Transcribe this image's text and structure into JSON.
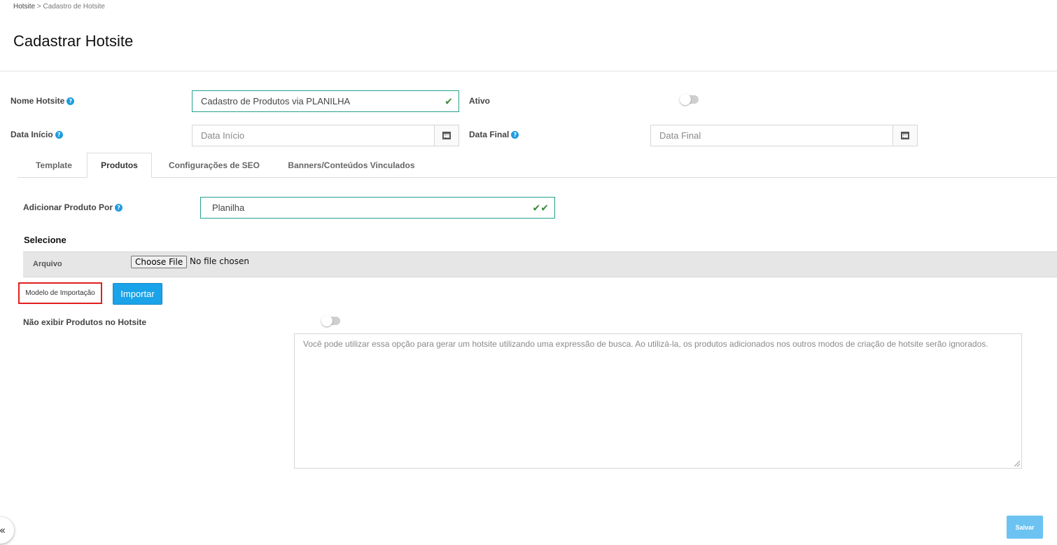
{
  "breadcrumb": {
    "root": "Hotsite",
    "separator": ">",
    "current": "Cadastro de Hotsite"
  },
  "page_title": "Cadastrar Hotsite",
  "form": {
    "nome_hotsite": {
      "label": "Nome Hotsite",
      "value": "Cadastro de Produtos via PLANILHA",
      "valid": true
    },
    "ativo": {
      "label": "Ativo",
      "on": false
    },
    "data_inicio": {
      "label": "Data Início",
      "placeholder": "Data Início",
      "icon": "calendar-icon"
    },
    "data_final": {
      "label": "Data Final",
      "placeholder": "Data Final",
      "icon": "calendar-icon"
    }
  },
  "tabs": [
    {
      "label": "Template",
      "active": false
    },
    {
      "label": "Produtos",
      "active": true
    },
    {
      "label": "Configurações de SEO",
      "active": false
    },
    {
      "label": "Banners/Conteúdos Vinculados",
      "active": false
    }
  ],
  "produtos": {
    "adicionar_por": {
      "label": "Adicionar Produto Por",
      "value": "Planilha"
    },
    "selecione_title": "Selecione",
    "arquivo": {
      "label": "Arquivo",
      "button": "Choose File",
      "status": "No file chosen"
    },
    "modelo_importacao": "Modelo de Importação",
    "importar_button": "Importar",
    "nao_exibir": {
      "label": "Não exibir Produtos no Hotsite",
      "on": false
    },
    "textarea_placeholder": "Você pode utilizar essa opção para gerar um hotsite utilizando uma expressão de busca. Ao utilizá-la, os produtos adicionados nos outros modos de criação de hotsite serão ignorados."
  },
  "salvar_button": "Salvar",
  "collapse_glyph": "«",
  "colors": {
    "accent": "#1aa3e8",
    "valid_border": "#25a08e",
    "highlight": "#e02020",
    "save": "#6cc3f2"
  }
}
